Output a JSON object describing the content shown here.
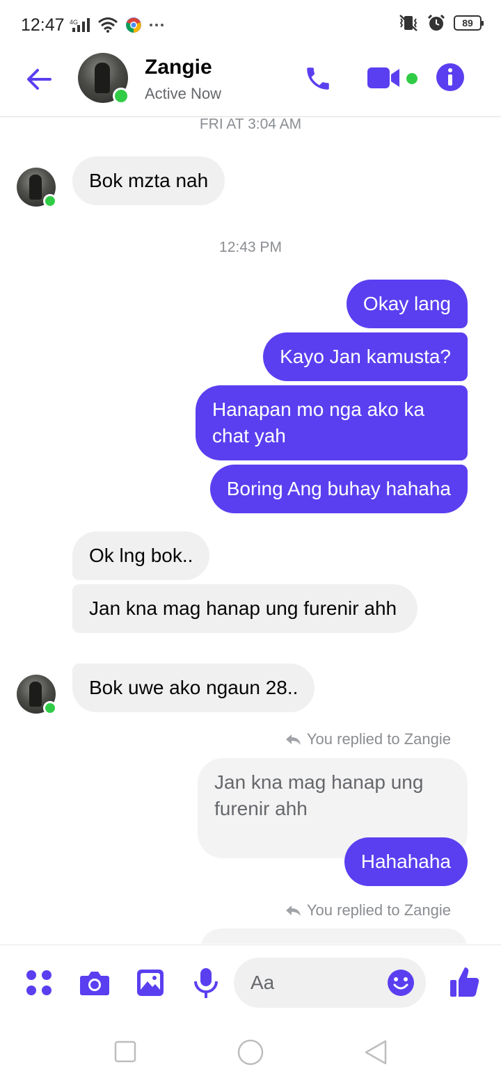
{
  "status_bar": {
    "time": "12:47",
    "battery": "89",
    "icons": [
      "signal-icon",
      "wifi-icon",
      "chrome-icon",
      "more-dots-icon",
      "vibrate-icon",
      "alarm-icon",
      "battery-icon"
    ]
  },
  "header": {
    "name": "Zangie",
    "status": "Active Now",
    "accent": "#5a3ff0",
    "online_color": "#31cc46",
    "icons": [
      "back-arrow-icon",
      "phone-icon",
      "video-camera-icon",
      "info-icon"
    ]
  },
  "messages": {
    "ts1": "FRI AT 3:04 AM",
    "m1": "Bok mzta nah",
    "ts2": "12:43 PM",
    "m2": "Okay lang",
    "m3": "Kayo Jan kamusta?",
    "m4": "Hanapan mo nga ako ka chat yah",
    "m5": "Boring Ang buhay hahaha",
    "m6": "Ok  lng bok..",
    "m7": "Jan kna mag hanap ung furenir ahh",
    "m8": "Bok uwe ako ngaun 28..",
    "reply1": "You replied to Zangie",
    "quoted1": "Jan kna mag hanap ung furenir ahh",
    "m9": "Hahahaha",
    "reply2": "You replied to Zangie"
  },
  "composer": {
    "placeholder": "Aa",
    "icons": [
      "apps-grid-icon",
      "camera-icon",
      "gallery-icon",
      "microphone-icon",
      "emoji-icon",
      "thumbs-up-icon"
    ]
  },
  "nav": {
    "icons": [
      "recents-square-icon",
      "home-circle-icon",
      "back-triangle-icon"
    ]
  }
}
